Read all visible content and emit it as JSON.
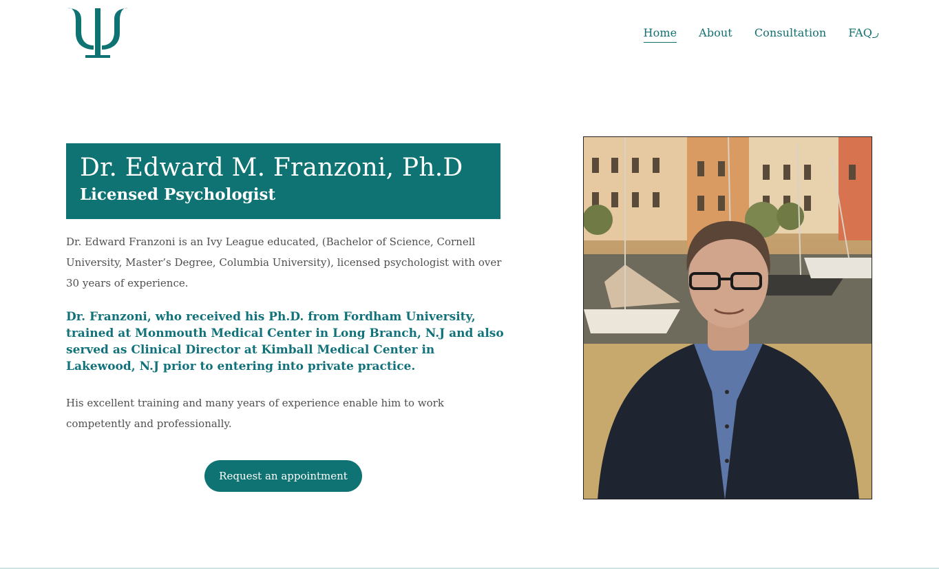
{
  "brand": {
    "logo_glyph": "Ψ",
    "accent": "#0f7373",
    "link": "#126f71"
  },
  "nav": {
    "items": [
      {
        "label": "Home",
        "active": true
      },
      {
        "label": "About",
        "active": false
      },
      {
        "label": "Consultation",
        "active": false
      },
      {
        "label": "FAQ",
        "active": false
      }
    ]
  },
  "hero": {
    "title": "Dr. Edward M. Franzoni, Ph.D",
    "subtitle": "Licensed Psychologist"
  },
  "content": {
    "para1": "Dr. Edward Franzoni is an Ivy League educated, (Bachelor of Science, Cornell University, Master’s Degree, Columbia University), licensed psychologist with over 30 years of experience.",
    "para2": "Dr. Franzoni, who received his Ph.D. from Fordham University, trained at Monmouth Medical Center in Long Branch, N.J and also served as Clinical Director at Kimball Medical Center in Lakewood, N.J prior to entering into private practice.",
    "para3": "His excellent training and many years of experience enable him to work competently and professionally."
  },
  "cta": {
    "label": "Request an appointment"
  }
}
